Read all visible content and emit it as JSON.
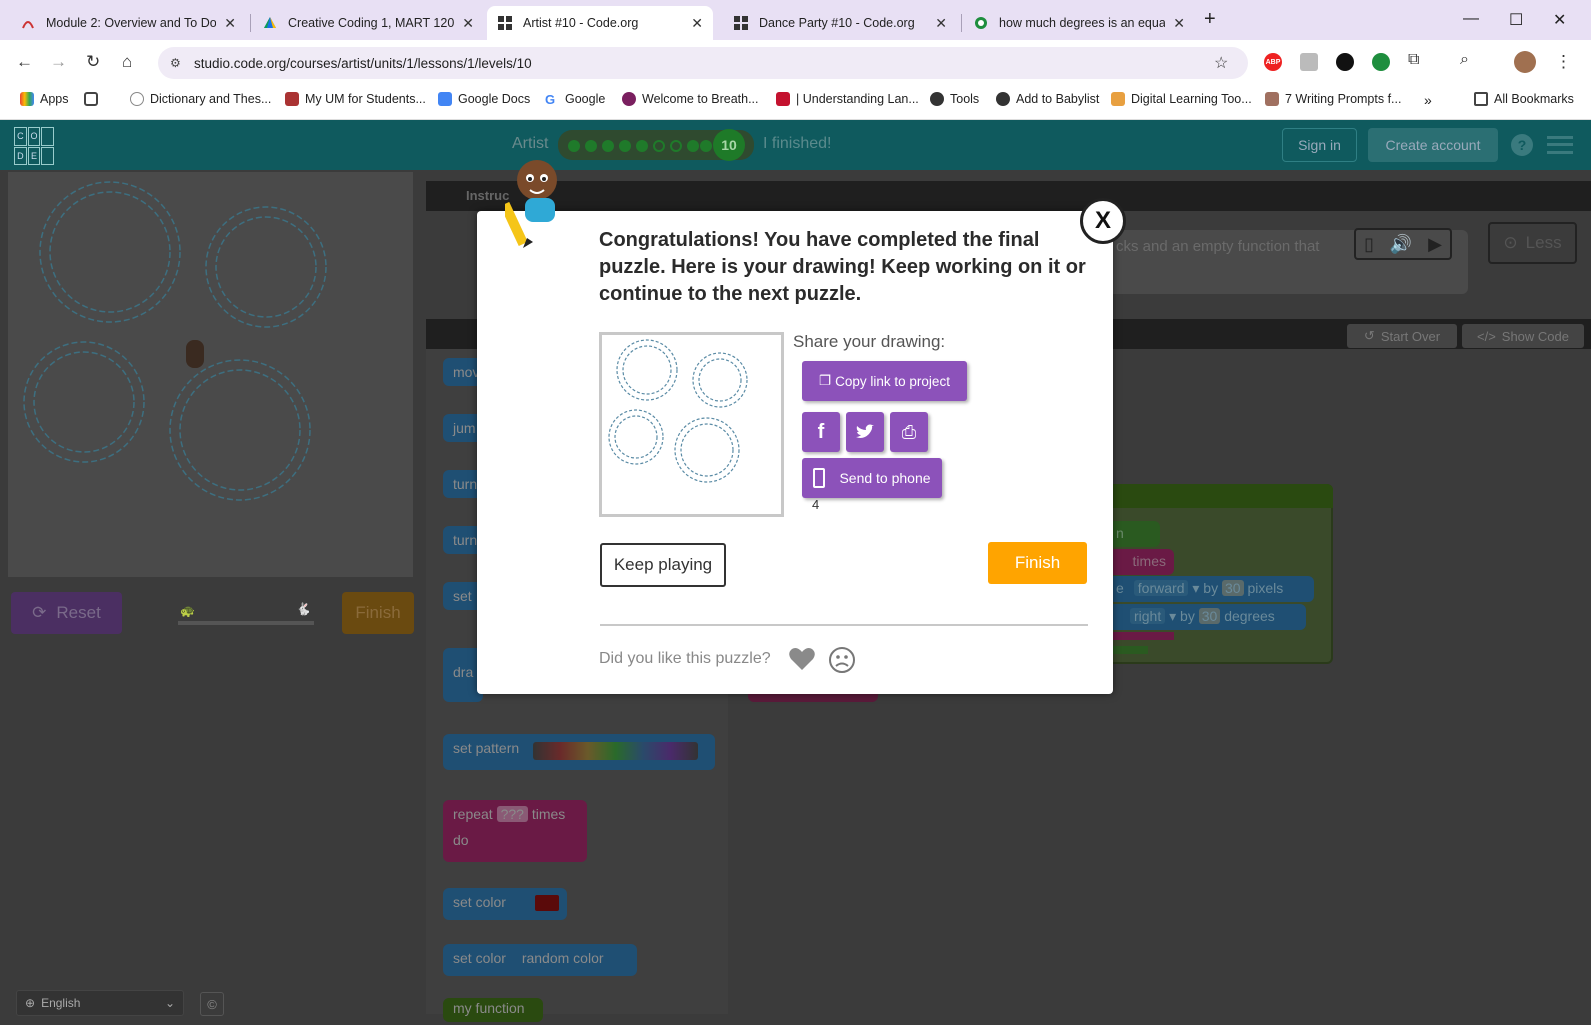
{
  "browser": {
    "tabs": [
      {
        "title": "Module 2: Overview and To Do"
      },
      {
        "title": "Creative Coding 1, MART 120 |"
      },
      {
        "title": "Artist #10 - Code.org"
      },
      {
        "title": "Dance Party #10 - Code.org"
      },
      {
        "title": "how much degrees is an equalt"
      }
    ],
    "url": "studio.code.org/courses/artist/units/1/lessons/1/levels/10",
    "bookmarks": [
      "Apps",
      "Dictionary and Thes...",
      "My UM for Students...",
      "Google Docs",
      "Google",
      "Welcome to Breath...",
      "| Understanding Lan...",
      "Tools",
      "Add to Babylist",
      "Digital Learning Too...",
      "7 Writing Prompts f..."
    ],
    "all_bookmarks": "All Bookmarks",
    "abp_label": "ABP"
  },
  "app": {
    "logo_letters": [
      "C",
      "O",
      "",
      "D",
      "E",
      ""
    ],
    "artist_label": "Artist",
    "level_number": "10",
    "finished_label": "I finished!",
    "sign_in": "Sign in",
    "create_account": "Create account",
    "help": "?"
  },
  "workspace": {
    "instructions_tab": "Instruc",
    "instruction_snippet": "cks and an empty function that",
    "less_label": "Less",
    "start_over": "Start Over",
    "show_code": "Show Code",
    "reset": "Reset",
    "finish_bottom": "Finish",
    "toolbox": [
      "mov",
      "jum",
      "turn",
      "turn",
      "set",
      "dra",
      "set pattern",
      "repeat",
      "do",
      "set color",
      "set color",
      "random color",
      "my function"
    ],
    "repeat_value": "???",
    "repeat_times": "times",
    "code_tokens": [
      "n",
      "times",
      "e",
      "forward",
      "by",
      "30",
      "pixels",
      "right",
      "by",
      "30",
      "degrees"
    ],
    "language": "English"
  },
  "modal": {
    "close": "X",
    "message": "Congratulations! You have completed the final puzzle. Here is your drawing! Keep working on it or continue to the next puzzle.",
    "share_label": "Share your drawing:",
    "copy_link": "Copy link to project",
    "send_to_phone": "Send to phone",
    "count": "4",
    "keep_playing": "Keep playing",
    "finish": "Finish",
    "liked_question": "Did you like this puzzle?"
  }
}
